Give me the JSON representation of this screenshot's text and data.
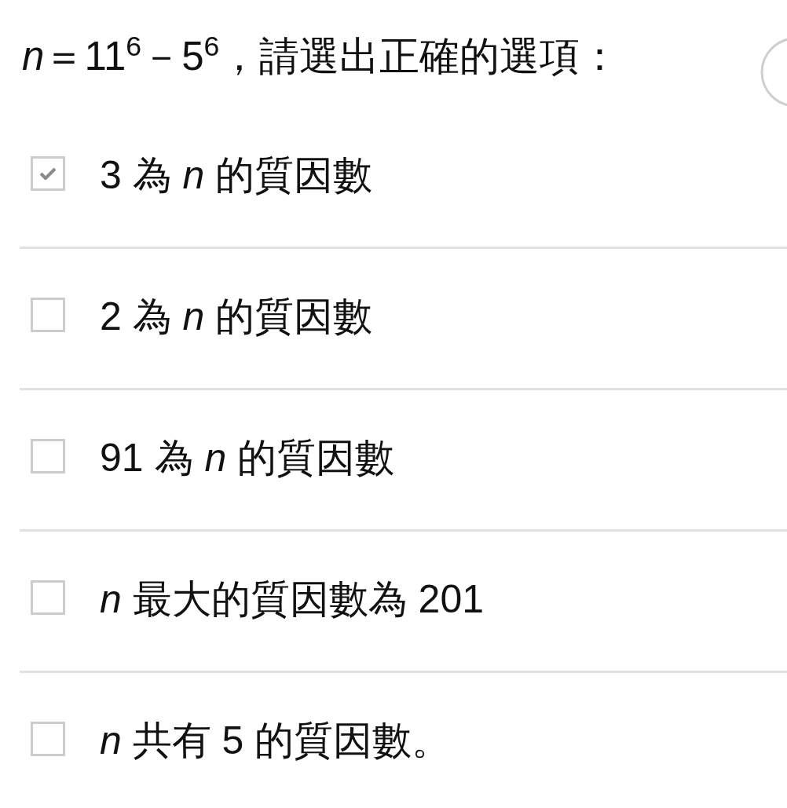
{
  "question": {
    "text": "*n*＝11$^{6}$－5$^{6}$，請選出正確的選項："
  },
  "options": [
    {
      "label": "3 為 *n* 的質因數",
      "checked": true
    },
    {
      "label": "2 為 *n* 的質因數",
      "checked": false
    },
    {
      "label": "91 為 *n* 的質因數",
      "checked": false
    },
    {
      "label": "*n* 最大的質因數為 201",
      "checked": false
    },
    {
      "label": "*n* 共有 5 的質因數。",
      "checked": false
    }
  ]
}
